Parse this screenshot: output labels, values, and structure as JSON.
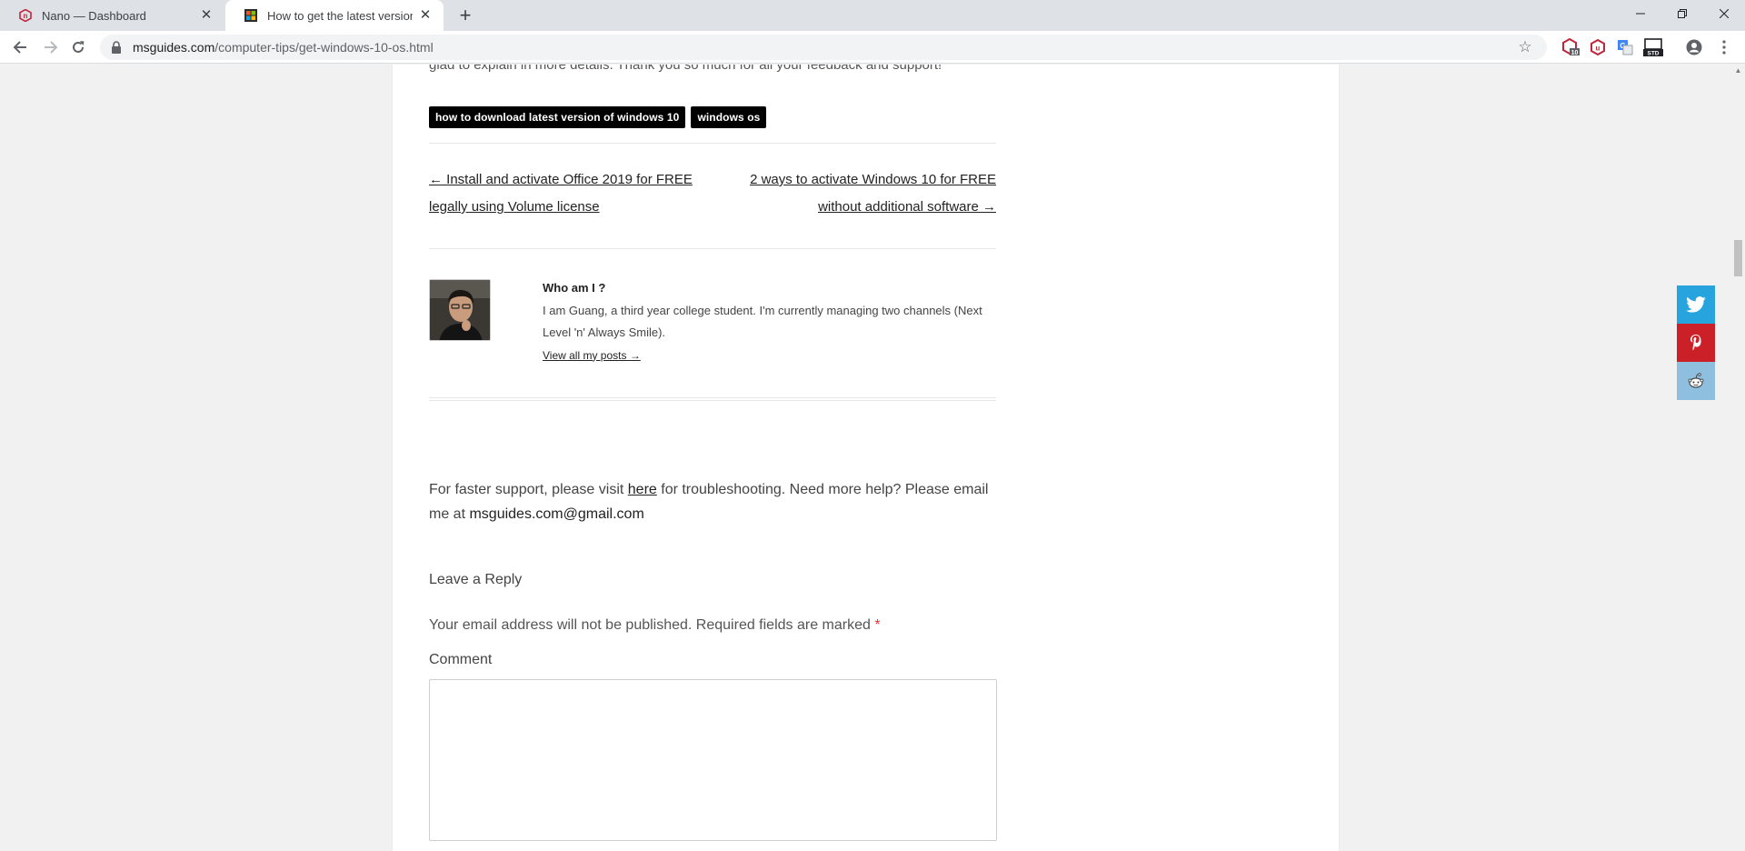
{
  "browser": {
    "tabs": [
      {
        "title": "Nano — Dashboard",
        "active": false
      },
      {
        "title": "How to get the latest version of W",
        "active": true
      }
    ],
    "url_host": "msguides.com",
    "url_path": "/computer-tips/get-windows-10-os.html"
  },
  "article": {
    "cut_text": "glad to explain in more details. Thank you so much for all your feedback and support!",
    "tags": [
      "how to download latest version of windows 10",
      "windows os"
    ],
    "prev_post": "← Install and activate Office 2019 for FREE legally using Volume license",
    "next_post": "2 ways to activate Windows 10 for FREE without additional software →"
  },
  "author": {
    "heading": "Who am I ?",
    "bio": "I am Guang, a third year college student. I'm currently managing two channels (Next Level 'n' Always Smile).",
    "link": "View all my posts →"
  },
  "support": {
    "prefix": "For faster support, please visit ",
    "link_text": "here",
    "middle": " for troubleshooting. Need more help? Please email me at ",
    "email": "msguides.com@gmail.com"
  },
  "reply": {
    "title": "Leave a Reply",
    "notes": "Your email address will not be published. Required fields are marked ",
    "required_mark": "*",
    "comment_label": "Comment"
  },
  "colors": {
    "twitter": "#27a4dd",
    "pinterest": "#cb2027",
    "reddit": "#8fbfde"
  }
}
